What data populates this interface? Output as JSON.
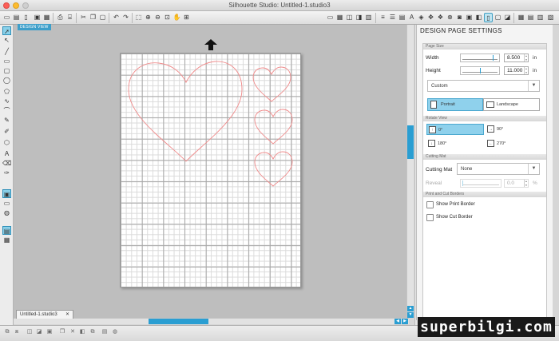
{
  "window": {
    "title": "Silhouette Studio: Untitled-1.studio3"
  },
  "workspace": {
    "design_view_tag": "DESIGN VIEW",
    "document_tab": "Untitled-1.studio3"
  },
  "panel": {
    "title": "DESIGN PAGE SETTINGS",
    "page_size": {
      "header": "Page Size",
      "width_label": "Width",
      "width_value": "8.500",
      "height_label": "Height",
      "height_value": "11.000",
      "unit": "in",
      "preset": "Custom"
    },
    "orientation": {
      "portrait_label": "Portrait",
      "landscape_label": "Landscape",
      "selected": "Portrait"
    },
    "rotate_view": {
      "header": "Rotate View",
      "options": [
        "0°",
        "90°",
        "180°",
        "270°"
      ],
      "selected": "0°"
    },
    "cutting_mat": {
      "header": "Cutting Mat",
      "label": "Cutting Mat",
      "value": "None",
      "reveal_label": "Reveal",
      "reveal_value": "0.0",
      "reveal_unit": "%"
    },
    "borders": {
      "header": "Print and Cut Borders",
      "print_border_label": "Show Print Border",
      "cut_border_label": "Show Cut Border",
      "print_border_checked": false,
      "cut_border_checked": false
    }
  },
  "watermark": "superbilgi.com",
  "colors": {
    "accent": "#2a9ed2",
    "heart_stroke": "#f08a8a",
    "selected": "#8fd1ec"
  },
  "icons": {
    "toolbar": [
      "new-doc-icon",
      "open-icon",
      "save-icon",
      "save-as-icon",
      "print-icon",
      "cut-icon",
      "copy-icon",
      "paste-icon",
      "undo-icon",
      "redo-icon",
      "select-icon",
      "zoom-in-icon",
      "zoom-out-icon",
      "zoom-fit-icon",
      "pan-icon",
      "zoom-page-icon"
    ],
    "left": [
      "pointer-icon",
      "edit-points-icon",
      "line-icon",
      "rectangle-icon",
      "rounded-rect-icon",
      "ellipse-icon",
      "polygon-icon",
      "curve-icon",
      "arc-icon",
      "freehand-icon",
      "text-icon",
      "eraser-icon",
      "knife-icon"
    ]
  }
}
